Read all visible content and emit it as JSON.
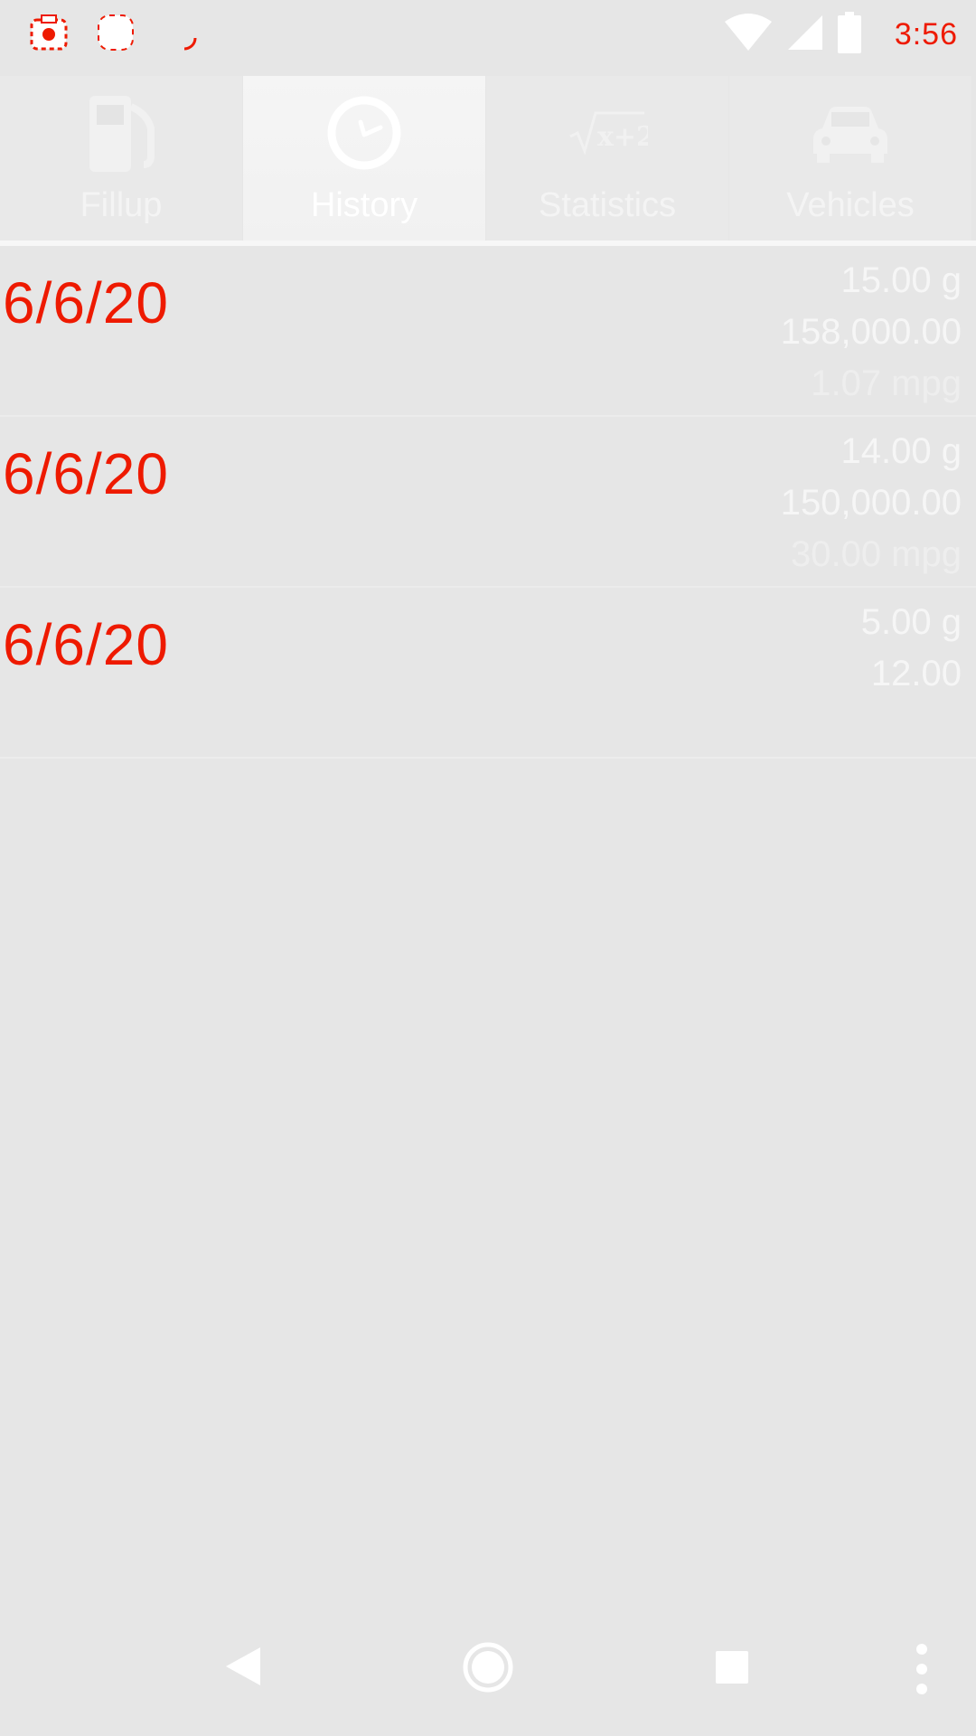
{
  "status_bar": {
    "time": "3:56",
    "icons": [
      "camera-icon",
      "circle-app-icon",
      "sync-icon",
      "wifi-icon",
      "signal-icon",
      "battery-icon"
    ]
  },
  "tabs": [
    {
      "label": "Fillup",
      "icon": "fuel-pump-icon",
      "active": false
    },
    {
      "label": "History",
      "icon": "clock-icon",
      "active": true
    },
    {
      "label": "Statistics",
      "icon": "sqrt-icon",
      "active": false
    },
    {
      "label": "Vehicles",
      "icon": "car-icon",
      "active": false
    }
  ],
  "history": [
    {
      "date": "6/6/20",
      "gallons": "15.00 g",
      "odometer": "158,000.00",
      "mpg": "1.07 mpg"
    },
    {
      "date": "6/6/20",
      "gallons": "14.00 g",
      "odometer": "150,000.00",
      "mpg": "30.00 mpg"
    },
    {
      "date": "6/6/20",
      "gallons": "5.00 g",
      "odometer": "12.00",
      "mpg": ""
    }
  ],
  "colors": {
    "accent": "#ee1a00",
    "background": "#e6e6e6",
    "text_light": "#f6f6f6"
  },
  "nav_bar": {
    "icons": [
      "back-icon",
      "home-icon",
      "recents-icon",
      "more-options-icon"
    ]
  }
}
